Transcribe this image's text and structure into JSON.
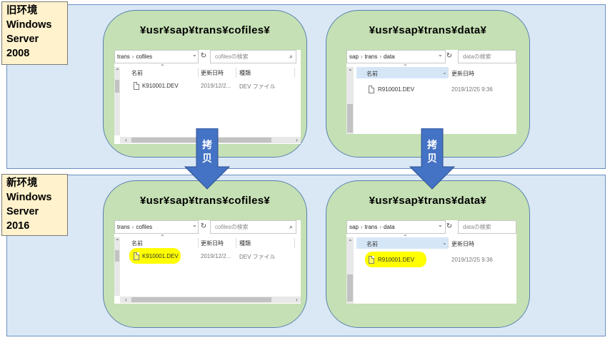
{
  "environments": {
    "old": {
      "lines": [
        "旧环境",
        "Windows",
        "Server",
        "2008"
      ]
    },
    "new": {
      "lines": [
        "新环境",
        "Windows",
        "Server",
        "2016"
      ]
    }
  },
  "panels": {
    "cofiles_title": "¥usr¥sap¥trans¥cofiles¥",
    "data_title": "¥usr¥sap¥trans¥data¥"
  },
  "explorer_cofiles": {
    "path": [
      "trans",
      "cofiles"
    ],
    "search_placeholder": "cofilesの検索",
    "columns": [
      "名前",
      "更新日時",
      "種類"
    ],
    "file": {
      "name": "K910001.DEV",
      "date": "2019/12/2...",
      "type": "DEV ファイル"
    }
  },
  "explorer_data": {
    "path": [
      "sap",
      "trans",
      "data"
    ],
    "search_placeholder": "dataの検索",
    "columns": [
      "名前",
      "更新日時"
    ],
    "file": {
      "name": "R910001.DEV",
      "date": "2019/12/25 9:36"
    }
  },
  "arrows": {
    "copy_label": [
      "拷",
      "贝"
    ]
  },
  "colors": {
    "band": "#dae8f5",
    "panel": "#c5e0b4",
    "label": "#fff2cc",
    "arrow": "#4472c4",
    "highlight": "#ffff00"
  }
}
